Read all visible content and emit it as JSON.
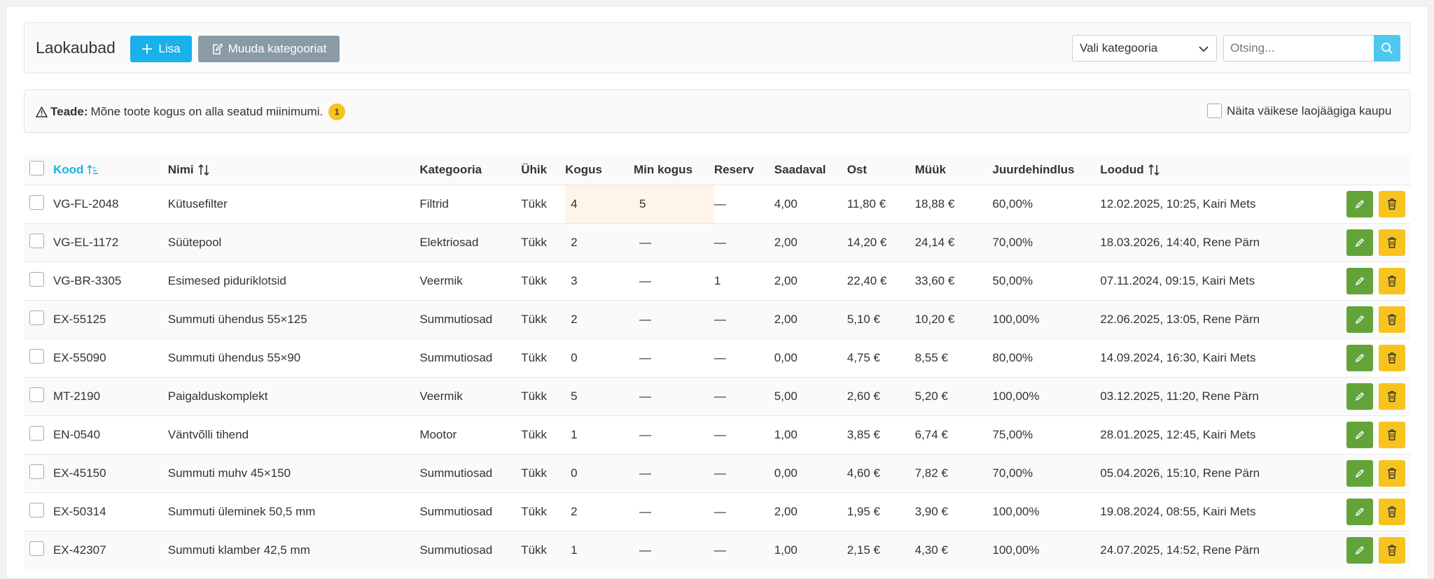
{
  "header": {
    "title": "Laokaubad",
    "add_label": "Lisa",
    "edit_categories_label": "Muuda kategooriat",
    "category_select": "Vali kategooria",
    "search_placeholder": "Otsing..."
  },
  "notice": {
    "label": "Teade:",
    "message": "Mõne toote kogus on alla seatud miinimumi.",
    "count": "1",
    "small_stock_label": "Näita väikese laojäägiga kaupu"
  },
  "table": {
    "columns": {
      "code": "Kood",
      "name": "Nimi",
      "category": "Kategooria",
      "unit": "Ühik",
      "qty": "Kogus",
      "min_qty": "Min kogus",
      "reserve": "Reserv",
      "available": "Saadaval",
      "buy": "Ost",
      "sell": "Müük",
      "markup": "Juurdehindlus",
      "created": "Loodud"
    },
    "rows": [
      {
        "code": "VG-FL-2048",
        "name": "Kütusefilter",
        "category": "Filtrid",
        "unit": "Tükk",
        "qty": "4",
        "min_qty": "5",
        "reserve": "—",
        "available": "4,00",
        "buy": "11,80 €",
        "sell": "18,88 €",
        "markup": "60,00%",
        "created": "12.02.2025, 10:25, Kairi Mets"
      },
      {
        "code": "VG-EL-1172",
        "name": "Süütepool",
        "category": "Elektriosad",
        "unit": "Tükk",
        "qty": "2",
        "min_qty": "—",
        "reserve": "—",
        "available": "2,00",
        "buy": "14,20 €",
        "sell": "24,14 €",
        "markup": "70,00%",
        "created": "18.03.2026, 14:40, Rene Pärn"
      },
      {
        "code": "VG-BR-3305",
        "name": "Esimesed piduriklotsid",
        "category": "Veermik",
        "unit": "Tükk",
        "qty": "3",
        "min_qty": "—",
        "reserve": "1",
        "available": "2,00",
        "buy": "22,40 €",
        "sell": "33,60 €",
        "markup": "50,00%",
        "created": "07.11.2024, 09:15, Kairi Mets"
      },
      {
        "code": "EX-55125",
        "name": "Summuti ühendus 55×125",
        "category": "Summutiosad",
        "unit": "Tükk",
        "qty": "2",
        "min_qty": "—",
        "reserve": "—",
        "available": "2,00",
        "buy": "5,10 €",
        "sell": "10,20 €",
        "markup": "100,00%",
        "created": "22.06.2025, 13:05, Rene Pärn"
      },
      {
        "code": "EX-55090",
        "name": "Summuti ühendus 55×90",
        "category": "Summutiosad",
        "unit": "Tükk",
        "qty": "0",
        "min_qty": "—",
        "reserve": "—",
        "available": "0,00",
        "buy": "4,75 €",
        "sell": "8,55 €",
        "markup": "80,00%",
        "created": "14.09.2024, 16:30, Kairi Mets"
      },
      {
        "code": "MT-2190",
        "name": "Paigalduskomplekt",
        "category": "Veermik",
        "unit": "Tükk",
        "qty": "5",
        "min_qty": "—",
        "reserve": "—",
        "available": "5,00",
        "buy": "2,60 €",
        "sell": "5,20 €",
        "markup": "100,00%",
        "created": "03.12.2025, 11:20, Rene Pärn"
      },
      {
        "code": "EN-0540",
        "name": "Väntvõlli tihend",
        "category": "Mootor",
        "unit": "Tükk",
        "qty": "1",
        "min_qty": "—",
        "reserve": "—",
        "available": "1,00",
        "buy": "3,85 €",
        "sell": "6,74 €",
        "markup": "75,00%",
        "created": "28.01.2025, 12:45, Kairi Mets"
      },
      {
        "code": "EX-45150",
        "name": "Summuti muhv 45×150",
        "category": "Summutiosad",
        "unit": "Tükk",
        "qty": "0",
        "min_qty": "—",
        "reserve": "—",
        "available": "0,00",
        "buy": "4,60 €",
        "sell": "7,82 €",
        "markup": "70,00%",
        "created": "05.04.2026, 15:10, Rene Pärn"
      },
      {
        "code": "EX-50314",
        "name": "Summuti üleminek 50,5 mm",
        "category": "Summutiosad",
        "unit": "Tükk",
        "qty": "2",
        "min_qty": "—",
        "reserve": "—",
        "available": "2,00",
        "buy": "1,95 €",
        "sell": "3,90 €",
        "markup": "100,00%",
        "created": "19.08.2024, 08:55, Kairi Mets"
      },
      {
        "code": "EX-42307",
        "name": "Summuti klamber 42,5 mm",
        "category": "Summutiosad",
        "unit": "Tükk",
        "qty": "1",
        "min_qty": "—",
        "reserve": "—",
        "available": "1,00",
        "buy": "2,15 €",
        "sell": "4,30 €",
        "markup": "100,00%",
        "created": "24.07.2025, 14:52, Rene Pärn"
      }
    ]
  },
  "colors": {
    "primary": "#1ab0ea",
    "secondary": "#8a9ba6",
    "edit": "#62a43a",
    "delete": "#f7c31f",
    "warning_row": "#fff4ea"
  }
}
